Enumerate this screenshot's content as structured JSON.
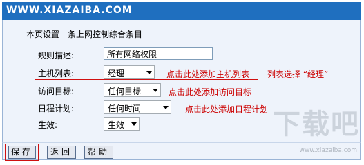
{
  "header": {
    "title": "WWW.XIAZAIBA.COM"
  },
  "form": {
    "intro": "本页设置一条上网控制综合条目",
    "rule_desc": {
      "label": "规则描述:",
      "value": "所有网络权限"
    },
    "host_list": {
      "label": "主机列表:",
      "selected": "经理",
      "link": "点击此处添加主机列表"
    },
    "access_target": {
      "label": "访问目标:",
      "selected": "任何目标",
      "link": "点击此处添加访问目标"
    },
    "schedule": {
      "label": "日程计划:",
      "selected": "任何时间",
      "link": "点击此处添加日程计划"
    },
    "effect": {
      "label": "生效:",
      "selected": "生效"
    }
  },
  "annotation": {
    "note": "列表选择 “经理”"
  },
  "buttons": {
    "save": "保存",
    "back": "返回",
    "help": "帮助"
  },
  "watermark": {
    "text": "下载吧",
    "sub": "www.xiazaiba.com"
  }
}
